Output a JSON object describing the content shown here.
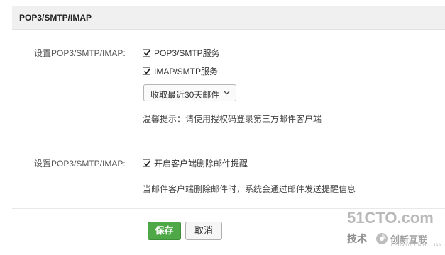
{
  "header": {
    "title": "POP3/SMTP/IMAP"
  },
  "section1": {
    "label": "设置POP3/SMTP/IMAP:",
    "options": [
      {
        "label": "POP3/SMTP服务",
        "checked": true
      },
      {
        "label": "IMAP/SMTP服务",
        "checked": true
      }
    ],
    "receive_select": {
      "selected": "收取最近30天邮件"
    },
    "tip": "温馨提示：请使用授权码登录第三方邮件客户端"
  },
  "section2": {
    "label": "设置POP3/SMTP/IMAP:",
    "option": {
      "label": "开启客户端删除邮件提醒",
      "checked": true
    },
    "note": "当邮件客户端删除邮件时，系统会通过邮件发送提醒信息"
  },
  "actions": {
    "save_label": "保存",
    "cancel_label": "取消"
  },
  "watermark": {
    "line1": "51CTO.com",
    "line2_left": "技术",
    "line2_right": "创新互联",
    "line3": "CHUANG XIN HU LIAN"
  },
  "colors": {
    "save_button": "#4ea847",
    "header_bg": "#f0f0f0",
    "text": "#333333"
  }
}
